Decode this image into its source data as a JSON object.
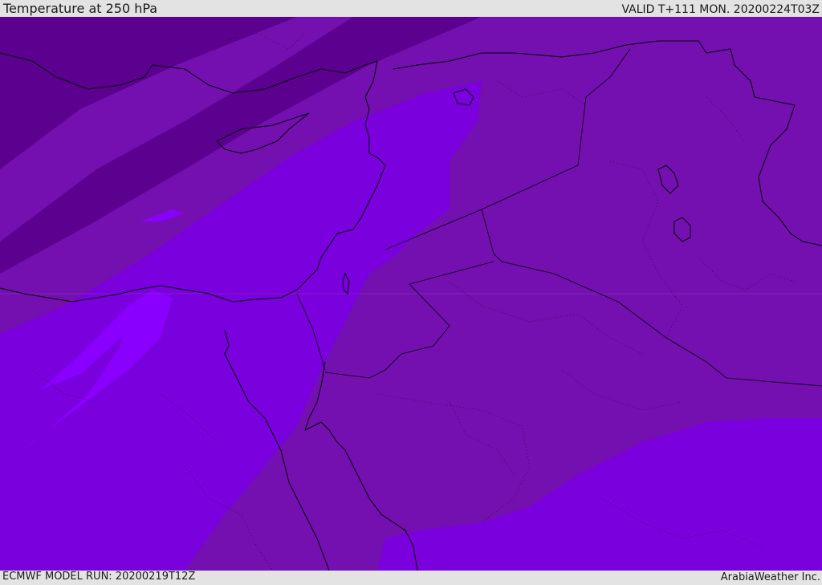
{
  "header": {
    "title": "Temperature at 250 hPa",
    "valid": "VALID T+111 MON. 20200224T03Z"
  },
  "footer": {
    "model_run": "ECMWF MODEL RUN: 20200219T12Z",
    "credit": "ArabiaWeather Inc."
  },
  "map": {
    "field": "temperature",
    "level": "250 hPa",
    "colors": {
      "very_cold": "#5c0090",
      "cold": "#6a00a0",
      "cool": "#7410b0",
      "mild": "#7a00dd",
      "warm": "#8a00ff",
      "coast_line": "#000000"
    }
  }
}
